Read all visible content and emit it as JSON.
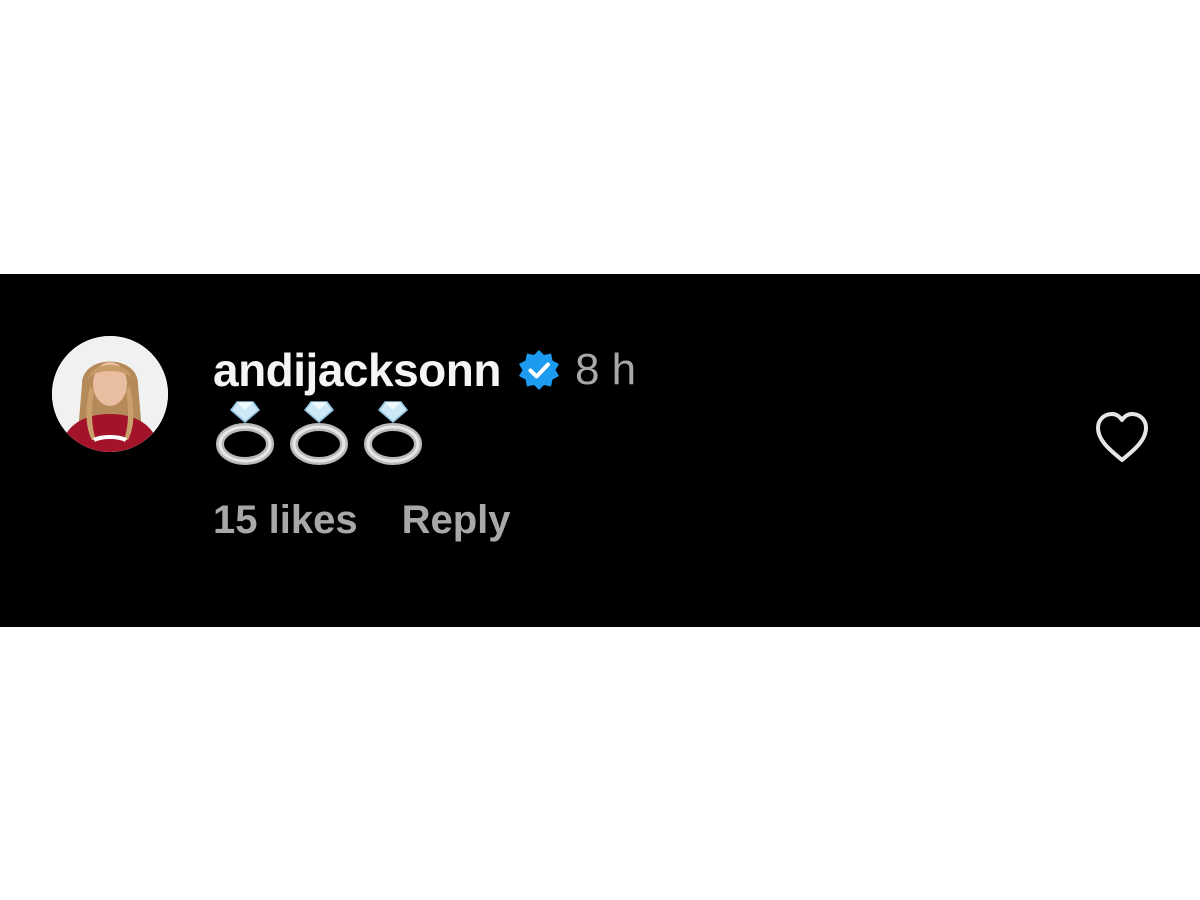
{
  "comment": {
    "username": "andijacksonn",
    "verified_icon": "verified-badge-icon",
    "timestamp": "8 h",
    "body_emojis": [
      "ring-emoji",
      "ring-emoji",
      "ring-emoji"
    ],
    "likes": "15 likes",
    "reply_label": "Reply",
    "like_icon": "heart-outline-icon"
  },
  "colors": {
    "panel_background": "#000000",
    "page_background": "#ffffff",
    "username": "#f5f5f5",
    "secondary_text": "#a8a8a8",
    "verified_badge": "#1d9bf0"
  }
}
